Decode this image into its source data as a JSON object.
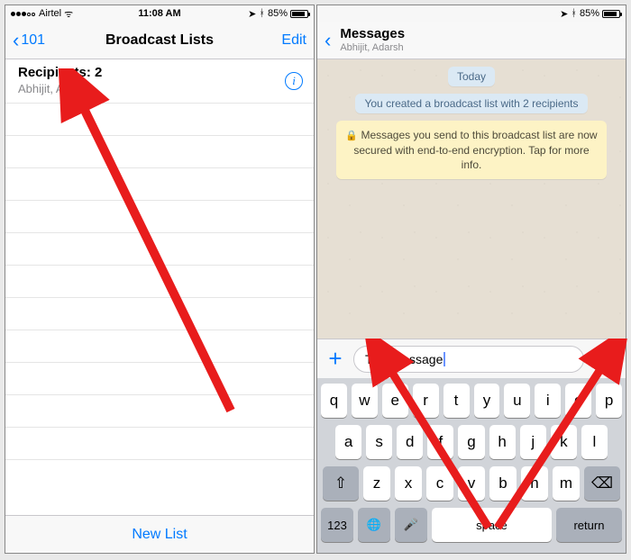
{
  "status": {
    "carrier": "Airtel",
    "time": "11:08 AM",
    "battery": "85%"
  },
  "left": {
    "back": "101",
    "title": "Broadcast Lists",
    "edit": "Edit",
    "recipients_label": "Recipients: 2",
    "recipients_names": "Abhijit, Adarsh",
    "new_list": "New List"
  },
  "right": {
    "title": "Messages",
    "subtitle": "Abhijit, Adarsh",
    "today": "Today",
    "created": "You created a broadcast list with 2 recipients",
    "encryption": "Messages you send to this broadcast list are now secured with end-to-end encryption. Tap for more info.",
    "input_value": "Test message"
  },
  "keyboard": {
    "r1": [
      "q",
      "w",
      "e",
      "r",
      "t",
      "y",
      "u",
      "i",
      "o",
      "p"
    ],
    "r2": [
      "a",
      "s",
      "d",
      "f",
      "g",
      "h",
      "j",
      "k",
      "l"
    ],
    "r3": [
      "z",
      "x",
      "c",
      "v",
      "b",
      "n",
      "m"
    ],
    "num": "123",
    "space": "space",
    "return": "return"
  }
}
